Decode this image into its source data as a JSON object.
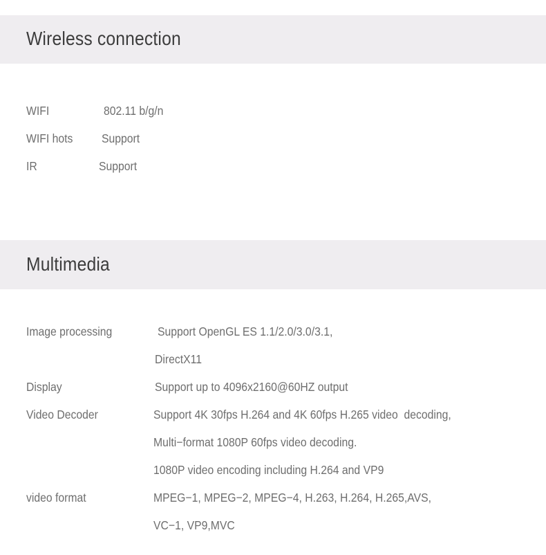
{
  "page": {
    "background_color": "#ffffff",
    "band_color": "#efedf0",
    "title_color": "#3c3c3c",
    "text_color": "#6e6e6e"
  },
  "sections": [
    {
      "id": "wireless-connection",
      "title": "Wireless connection",
      "rows": [
        {
          "label": "WIFI",
          "lines": [
            "802.11 b/g/n"
          ]
        },
        {
          "label": "WIFI hots",
          "lines": [
            "Support"
          ]
        },
        {
          "label": "IR",
          "lines": [
            "Support"
          ]
        }
      ]
    },
    {
      "id": "multimedia",
      "title": "Multimedia",
      "rows": [
        {
          "label": "Image processing",
          "lines": [
            "Support OpenGL ES 1.1/2.0/3.0/3.1,",
            "DirectX11"
          ]
        },
        {
          "label": "Display",
          "lines": [
            "Support up to 4096x2160@60HZ output"
          ]
        },
        {
          "label": "Video Decoder",
          "lines": [
            "Support 4K 30fps H.264 and 4K 60fps H.265 video  decoding,",
            "Multi−format 1080P 60fps video decoding.",
            "1080P video encoding including H.264 and VP9"
          ]
        },
        {
          "label": "video format",
          "lines": [
            "MPEG−1, MPEG−2, MPEG−4, H.263, H.264, H.265,AVS,",
            "VC−1, VP9,MVC"
          ]
        }
      ]
    }
  ]
}
